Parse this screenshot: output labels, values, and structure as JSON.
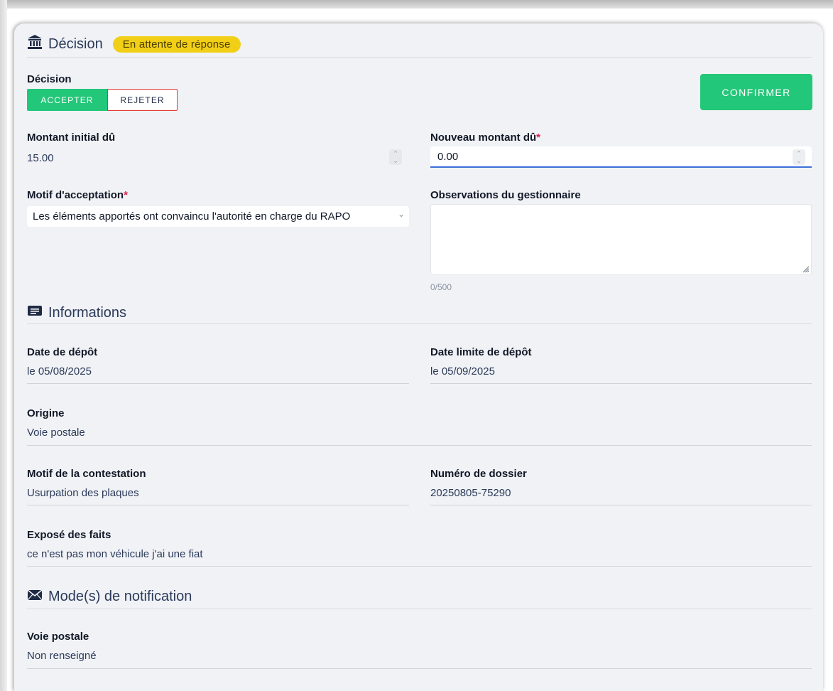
{
  "decision_section": {
    "title": "Décision",
    "status_badge": "En attente de réponse",
    "decision_label": "Décision",
    "accept_label": "ACCEPTER",
    "reject_label": "REJETER",
    "confirm_label": "CONFIRMER",
    "initial_amount_label": "Montant initial dû",
    "initial_amount_value": "15.00",
    "new_amount_label": "Nouveau montant dû",
    "new_amount_value": "0.00",
    "required_mark": "*",
    "acceptance_reason_label": "Motif d'acceptation",
    "acceptance_reason_value": "Les éléments apportés ont convaincu l'autorité en charge du RAPO",
    "observations_label": "Observations du gestionnaire",
    "observations_value": "",
    "observations_counter": "0/500"
  },
  "informations_section": {
    "title": "Informations",
    "deposit_date_label": "Date de dépôt",
    "deposit_date_value": "le 05/08/2025",
    "deadline_label": "Date limite de dépôt",
    "deadline_value": "le 05/09/2025",
    "origin_label": "Origine",
    "origin_value": "Voie postale",
    "contest_reason_label": "Motif de la contestation",
    "contest_reason_value": "Usurpation des plaques",
    "file_number_label": "Numéro de dossier",
    "file_number_value": "20250805-75290",
    "facts_label": "Exposé des faits",
    "facts_value": "ce n'est pas mon véhicule j'ai une fiat"
  },
  "notification_section": {
    "title": "Mode(s) de notification",
    "postal_label": "Voie postale",
    "postal_value": "Non renseigné"
  },
  "colors": {
    "accent_green": "#23c77a",
    "badge_yellow": "#f2cf17",
    "reject_border": "#e53935",
    "focus_blue": "#3b6fd8",
    "required_red": "#e11d48"
  },
  "icons": {
    "decision": "bank-building-icon",
    "informations": "message-icon",
    "notification": "envelope-icon"
  }
}
